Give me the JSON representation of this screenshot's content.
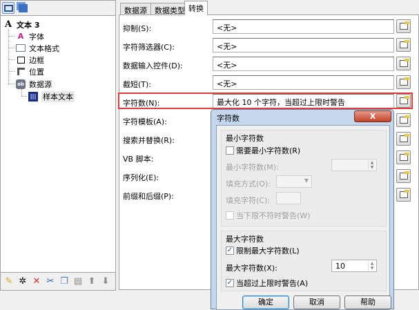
{
  "tree": {
    "root": "文本 3",
    "items": [
      "字体",
      "文本格式",
      "边框",
      "位置",
      "数据源"
    ],
    "child": "样本文本"
  },
  "tabs": [
    "数据源",
    "数据类型",
    "转换"
  ],
  "rows": [
    {
      "label": "抑制(S):",
      "value": "<无>"
    },
    {
      "label": "字符筛选器(C):",
      "value": "<无>"
    },
    {
      "label": "数据输入控件(D):",
      "value": "<无>"
    },
    {
      "label": "截短(T):",
      "value": "<无>"
    },
    {
      "label": "字符数(N):",
      "value": "最大化 10 个字符，当超过上限时警告"
    },
    {
      "label": "字符模板(A):"
    },
    {
      "label": "搜索并替换(R):"
    },
    {
      "label": "VB 脚本:"
    },
    {
      "label": "序列化(E):"
    },
    {
      "label": "前缀和后缀(P):"
    }
  ],
  "dialog": {
    "title": "字符数",
    "close": "X",
    "min_group": "最小字符数",
    "require_min": "需要最小字符数(R)",
    "require_min_checked": false,
    "min_count": "最小字符数(M):",
    "fill_mode": "填充方式(O):",
    "fill_char": "填充字符(C):",
    "warn_min": "当下限不符时警告(W)",
    "max_group": "最大字符数",
    "limit_max": "限制最大字符数(L)",
    "limit_max_checked": true,
    "max_count": "最大字符数(X):",
    "max_value": "10",
    "warn_max": "当超过上限时警告(A)",
    "warn_max_checked": true,
    "ok": "确定",
    "cancel": "取消",
    "help": "帮助"
  }
}
